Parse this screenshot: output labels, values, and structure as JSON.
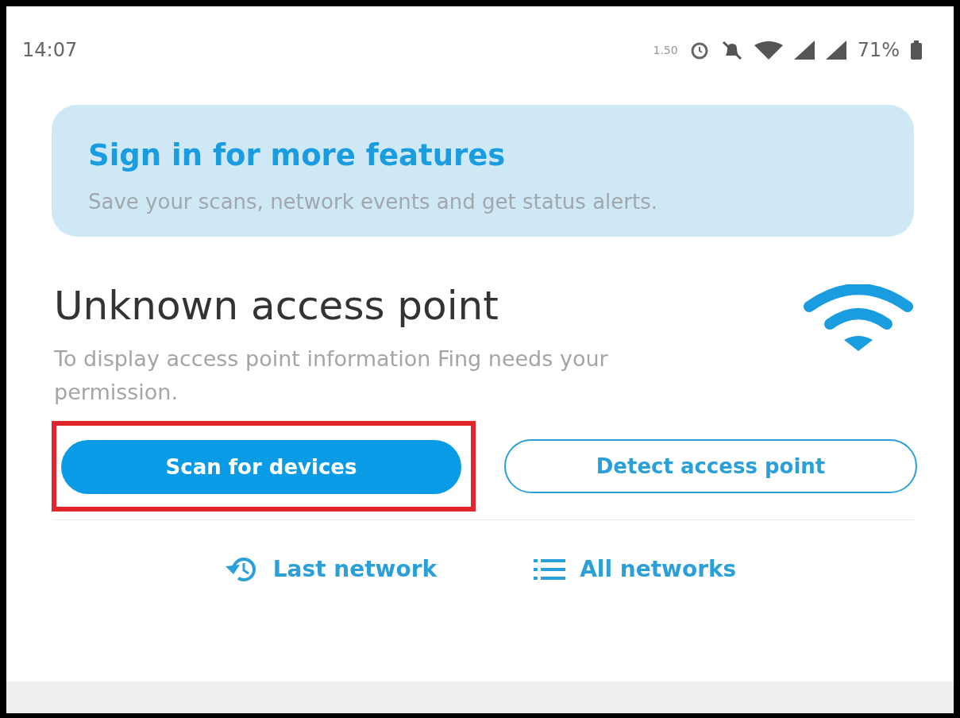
{
  "status_bar": {
    "time": "14:07",
    "net_speed": "1.50",
    "battery": "71%"
  },
  "banner": {
    "title": "Sign in for more features",
    "text": "Save your scans, network events and get status alerts."
  },
  "network": {
    "title": "Unknown access point",
    "text": "To display access point information Fing needs your permission."
  },
  "buttons": [
    {
      "label": "Scan for devices",
      "kind": "primary",
      "highlighted": true
    },
    {
      "label": "Detect access point",
      "kind": "outline",
      "highlighted": false
    }
  ],
  "links": [
    {
      "label": "Last network",
      "kind": "history"
    },
    {
      "label": "All networks",
      "kind": "list"
    }
  ]
}
